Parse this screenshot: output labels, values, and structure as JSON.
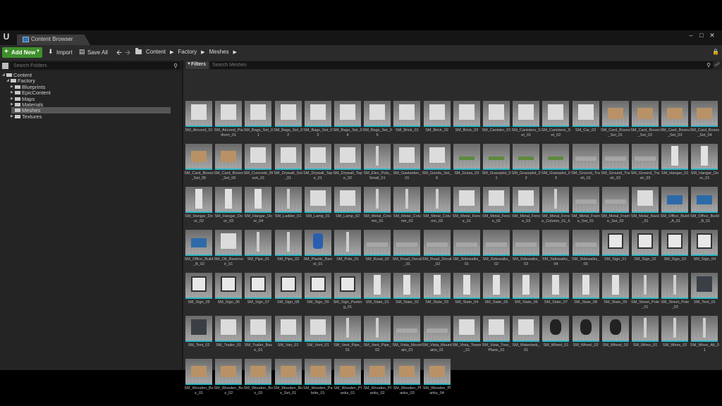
{
  "window": {
    "tab_title": "Content Browser",
    "controls": [
      "minimize-icon",
      "maximize-icon",
      "close-icon"
    ]
  },
  "toolbar": {
    "add_new_label": "Add New",
    "import_label": "Import",
    "save_all_label": "Save All",
    "breadcrumb": [
      "Content",
      "Factory",
      "Meshes"
    ]
  },
  "sources": {
    "search_placeholder": "Search Folders",
    "tree": [
      {
        "label": "Content",
        "depth": 0,
        "expanded": true,
        "selected": false
      },
      {
        "label": "Factory",
        "depth": 1,
        "expanded": true,
        "selected": false
      },
      {
        "label": "Blueprints",
        "depth": 2,
        "expanded": false,
        "selected": false
      },
      {
        "label": "EpicContent",
        "depth": 2,
        "expanded": false,
        "selected": false
      },
      {
        "label": "Maps",
        "depth": 2,
        "expanded": false,
        "selected": false
      },
      {
        "label": "Materials",
        "depth": 2,
        "expanded": false,
        "selected": false
      },
      {
        "label": "Meshes",
        "depth": 2,
        "expanded": false,
        "selected": true
      },
      {
        "label": "Textures",
        "depth": 2,
        "expanded": false,
        "selected": false
      }
    ]
  },
  "assets": {
    "filters_label": "Filters",
    "search_placeholder": "Search Meshes",
    "accent_color": "#2cb8c6",
    "items": [
      "SM_Aircond_01",
      "SM_Aircond_Platform_01",
      "SM_Bags_Set_01",
      "SM_Bags_Set_02",
      "SM_Bags_Set_03",
      "SM_Bags_Set_04",
      "SM_Bags_Set_05",
      "SM_Brick_01",
      "SM_Brick_02",
      "SM_Brick_03",
      "SM_Canister_01",
      "SM_Canisters_Set_01",
      "SM_Canisters_Set_02",
      "SM_Car_02",
      "SM_Card_Boxes_Set_01",
      "SM_Card_Boxes_Set_02",
      "SM_Card_Boxes_Set_03",
      "SM_Card_Boxes_Set_04",
      "SM_Card_Boxes_Set_05",
      "SM_Card_Boxes_Set_06",
      "SM_Concrete_Block_01",
      "SM_Drywall_Set_01",
      "SM_Drywall_Tape_01",
      "SM_Drywall_Tape_02",
      "SM_Elec_Pole_Small_01",
      "SM_Gastanker_01",
      "SM_Goods_Set_6",
      "SM_Grass_03",
      "SM_Grassplot_01",
      "SM_Grassplot_02",
      "SM_Grassplot_03",
      "SM_Ground_Trash_01",
      "SM_Ground_Trash_02",
      "SM_Ground_Trash_03",
      "SM_Hangar_01",
      "SM_Hangar_Door_01",
      "SM_Hangar_Door_02",
      "SM_Hangar_Door_03",
      "SM_Hangar_Door_04",
      "SM_Ladder_01",
      "SM_Lamp_01",
      "SM_Lamp_02",
      "SM_Metal_Column_01",
      "SM_Metal_Column_02",
      "SM_Metal_Column_03",
      "SM_Metal_Fence_01",
      "SM_Metal_Fence_02",
      "SM_Metal_Fence_03",
      "SM_Metal_Fence_Column_01_5",
      "SM_Metal_Frame_Set_01",
      "SM_Metal_Frame_Set_02",
      "SM_Metal_Rack_01",
      "SM_Office_Build_A_01",
      "SM_Office_Build_B_01",
      "SM_Office_Build_B_02",
      "SM_Oil_Reservoir_01",
      "SM_Pipe_01",
      "SM_Pipe_02",
      "SM_Plastic_Barrel_01",
      "SM_Pole_01",
      "SM_Road_02",
      "SM_Road_Decal_01",
      "SM_Road_Decal_02",
      "SM_Sidewalks_01",
      "SM_Sidewalks_02",
      "SM_Sidewalks_03",
      "SM_Sidewalks_04",
      "SM_Sidewalks_05",
      "SM_Sign_01",
      "SM_Sign_02",
      "SM_Sign_03",
      "SM_Sign_04",
      "SM_Sign_05",
      "SM_Sign_06",
      "SM_Sign_07",
      "SM_Sign_08",
      "SM_Sign_09",
      "SM_Sign_Parking_01",
      "SM_Slate_01",
      "SM_Slate_02",
      "SM_Slate_03",
      "SM_Slate_04",
      "SM_Slate_05",
      "SM_Slate_06",
      "SM_Slate_07",
      "SM_Slate_08",
      "SM_Slate_09",
      "SM_Street_Pole_01",
      "SM_Street_Pole_02",
      "SM_Tent_01",
      "SM_Tent_02",
      "SM_Trailer_01",
      "SM_Trailer_Base_01",
      "SM_Van_01",
      "SM_Vent_01",
      "SM_Vent_Pipe_01",
      "SM_Vent_Pipe_02",
      "SM_Vista_Mountain_01",
      "SM_Vista_Mountains_01",
      "SM_Vista_Tower_01",
      "SM_Vista_Tree_Plane_01",
      "SM_Watertank_01",
      "SM_Wheel_01",
      "SM_Wheel_02",
      "SM_Wheel_03",
      "SM_Wires_01",
      "SM_Wires_02",
      "SM_Wires_Alt_01",
      "SM_Wooden_Box_01",
      "SM_Wooden_Box_02",
      "SM_Wooden_Box_03",
      "SM_Wooden_Box_Set_01",
      "SM_Wooden_Palette_01",
      "SM_Wooden_Planks_01",
      "SM_Wooden_Planks_02",
      "SM_Wooden_Planks_03",
      "SM_Wooden_Planks_04"
    ]
  }
}
